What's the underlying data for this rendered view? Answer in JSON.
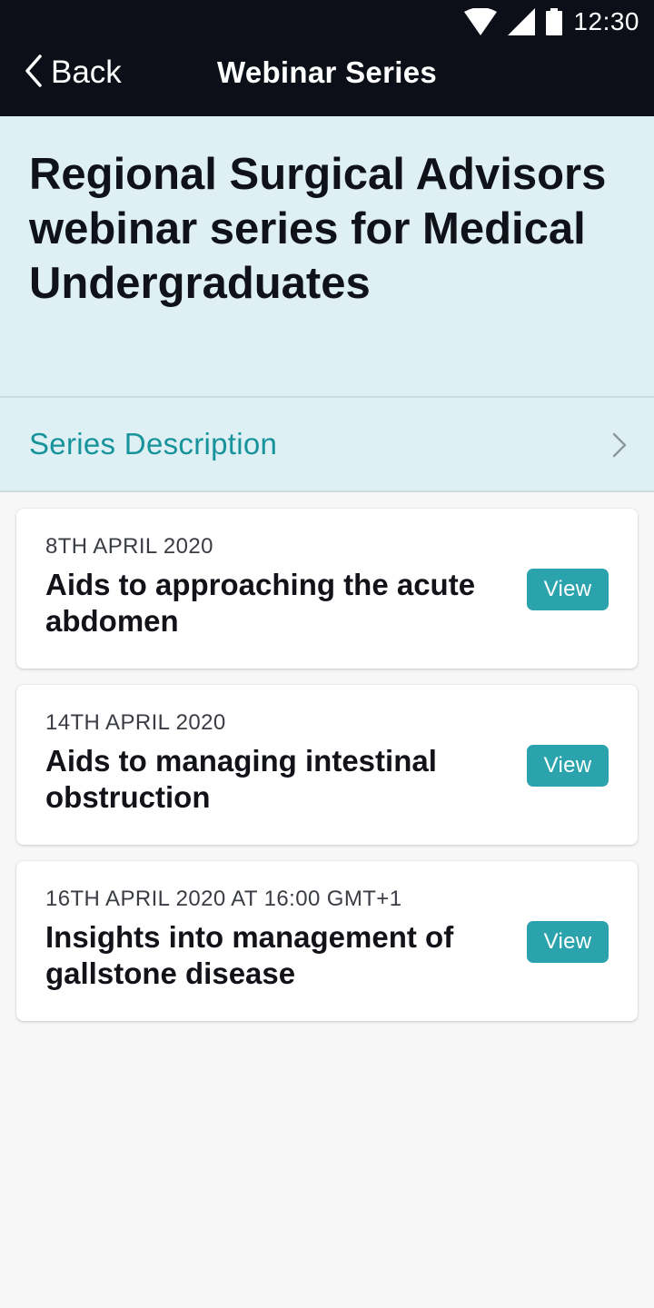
{
  "status_bar": {
    "time": "12:30",
    "icons": [
      "wifi-icon",
      "cell-signal-icon",
      "battery-icon"
    ]
  },
  "nav": {
    "back_label": "Back",
    "title": "Webinar Series"
  },
  "series": {
    "title": "Regional Surgical Advisors webinar series for Medical Undergraduates",
    "description_label": "Series Description"
  },
  "webinars": [
    {
      "date": "8TH APRIL 2020",
      "title": "Aids to approaching the acute abdomen",
      "button": "View"
    },
    {
      "date": "14TH APRIL 2020",
      "title": "Aids to managing intestinal obstruction",
      "button": "View"
    },
    {
      "date": "16TH APRIL 2020 AT 16:00 GMT+1",
      "title": "Insights into management of gallstone disease",
      "button": "View"
    }
  ],
  "colors": {
    "header_bg": "#0c0f17",
    "hero_bg": "#dff0f4",
    "accent": "#2ba3ad",
    "link_text": "#17939b",
    "page_bg": "#f7f7f7"
  }
}
